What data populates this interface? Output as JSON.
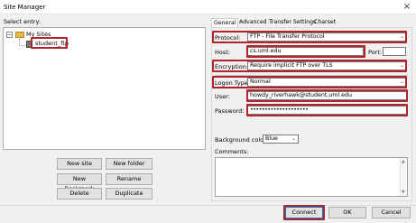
{
  "window": {
    "title": "Site Manager",
    "close_glyph": "×"
  },
  "tree": {
    "label": "Select entry:",
    "root": {
      "label": "My Sites",
      "expander": "−"
    },
    "site": {
      "label": "student_ftp"
    }
  },
  "left_buttons": {
    "new_site": "New site",
    "new_folder": "New folder",
    "new_bookmark": "New Bookmark",
    "rename": "Rename",
    "delete": "Delete",
    "duplicate": "Duplicate"
  },
  "tabs": [
    "General",
    "Advanced",
    "Transfer Settings",
    "Charset"
  ],
  "general": {
    "protocol": {
      "label": "Protocol:",
      "value": "FTP - File Transfer Protocol"
    },
    "host": {
      "label": "Host:",
      "value": "cs.uml.edu"
    },
    "port": {
      "label": "Port:",
      "value": ""
    },
    "encryption": {
      "label": "Encryption:",
      "value": "Require implicit FTP over TLS"
    },
    "logon_type": {
      "label": "Logon Type:",
      "value": "Normal"
    },
    "user": {
      "label": "User:",
      "value": "howdy_riverhawk@student.uml.edu"
    },
    "password": {
      "label": "Password:",
      "value": "••••••••••••••••••••"
    },
    "background_color": {
      "label": "Background color:",
      "value": "Blue"
    },
    "comments": {
      "label": "Comments:",
      "value": ""
    }
  },
  "dialog_buttons": {
    "connect": "Connect",
    "ok": "OK",
    "cancel": "Cancel"
  },
  "colors": {
    "highlight": "#b0252c",
    "folder": "#e8b84a"
  },
  "icons": {
    "dropdown": "⌄",
    "scroll_up": "▲",
    "scroll_down": "▼"
  }
}
